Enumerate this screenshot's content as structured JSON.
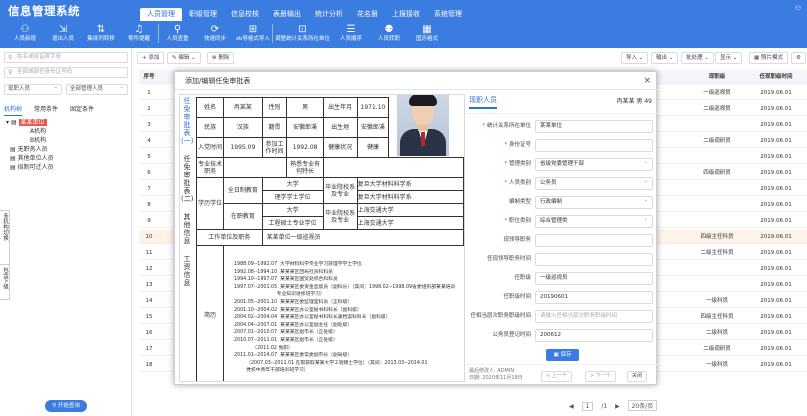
{
  "app": {
    "title": "信息管理系统"
  },
  "menu": [
    "人员管理",
    "职级管理",
    "信息校核",
    "表册输出",
    "统计分析",
    "花名册",
    "上报接收",
    "系统管理"
  ],
  "toolbar": [
    "人员新增",
    "退出人员",
    "集体列转移",
    "零件提醒",
    "人员查重",
    "快速同步",
    "zb导格式导入",
    "调整统计关系所在单位",
    "人员顺序",
    "人员转职",
    "国历格式"
  ],
  "sidebar": {
    "search1": "姓名或拼音首字母",
    "search2": "全部城部任身份证号码",
    "scope": "现职人员",
    "unit": "全部管理人员",
    "tabs": [
      "机构树",
      "常用条件",
      "固定条件"
    ],
    "tree": [
      "某某单位",
      "A机构",
      "B机构",
      "无职务人员",
      "其他单位人员",
      "拟制可迁人员"
    ],
    "vtab": "多机构切换",
    "vtab2": "包含下级",
    "start": "开始查询"
  },
  "main_toolbar": {
    "add": "添加",
    "edit": "编辑",
    "delete": "删除",
    "import": "导入",
    "export": "输出",
    "batch": "批处理",
    "display": "显示",
    "photo": "照片模式"
  },
  "grid": {
    "left_head": "序号",
    "cols": [
      "现职级",
      "任现职级时间"
    ],
    "rows": [
      {
        "no": "1",
        "rank": "一级巡视员",
        "date": "2019.06.01"
      },
      {
        "no": "2",
        "rank": "二级巡视员",
        "date": "2019.06.01"
      },
      {
        "no": "3",
        "rank": "",
        "date": "2019.06.01"
      },
      {
        "no": "4",
        "rank": "二级调研员",
        "date": "2019.06.01"
      },
      {
        "no": "5",
        "rank": "",
        "date": "2019.06.01"
      },
      {
        "no": "6",
        "rank": "四级调研员",
        "date": "2019.06.01"
      },
      {
        "no": "7",
        "rank": "",
        "date": "2019.06.01"
      },
      {
        "no": "8",
        "rank": "",
        "date": "2019.06.01"
      },
      {
        "no": "9",
        "rank": "",
        "date": "2019.06.01"
      },
      {
        "no": "10",
        "rank": "四级主任科员",
        "date": "2019.06.01"
      },
      {
        "no": "11",
        "rank": "二级主任科员",
        "date": "2019.06.01"
      },
      {
        "no": "12",
        "rank": "",
        "date": "2019.06.01"
      },
      {
        "no": "13",
        "rank": "",
        "date": "2019.06.01"
      },
      {
        "no": "14",
        "rank": "一级科员",
        "date": "2019.06.01"
      },
      {
        "no": "15",
        "rank": "四级主任科员",
        "date": "2019.06.01"
      },
      {
        "no": "16",
        "rank": "二级科员",
        "date": "2019.06.01"
      },
      {
        "no": "17",
        "rank": "二级调研员",
        "date": "2019.06.01"
      },
      {
        "no": "18",
        "rank": "一级科员",
        "date": "2019.06.01"
      }
    ]
  },
  "pager": {
    "page": "1",
    "total": "/1",
    "size": "20条/页"
  },
  "modal": {
    "title": "添加/编辑任免审批表",
    "close": "×",
    "vt": [
      "任免审批表(一)",
      "任免审批表(二)",
      "其他信息",
      "工资信息"
    ],
    "form": {
      "name_l": "姓名",
      "name": "冉某某",
      "sex_l": "性别",
      "sex": "男",
      "birth_l": "出生年月",
      "birth": "1971.10",
      "nation_l": "民族",
      "nation": "汉族",
      "native_l": "籍贯",
      "native": "安徽郎溪",
      "bp_l": "出生地",
      "bp": "安徽郎溪",
      "party_l": "入党时间",
      "party": "1995.09",
      "work_l": "参加工作时间",
      "work": "1992.08",
      "health_l": "健康状况",
      "health": "健康",
      "tech_l": "专业技术职务",
      "spec_l": "熟悉专业有何特长",
      "edu_l": "学历学位",
      "ft_l": "全日制教育",
      "ft_edu": "大学",
      "ft_deg": "理学学士学位",
      "ft_sch_l": "毕业院校系及专业",
      "ft_sch1": "复旦大学材料科学系",
      "ft_sch2": "复旦大学材料科学系",
      "ij_l": "在职教育",
      "ij_edu": "大学",
      "ij_deg": "工程硕士专业学位",
      "ij_sch_l": "毕业院校系及专业",
      "ij_sch1": "上海交通大学",
      "ij_sch2": "上海交通大学",
      "pos_l": "工作单位及职务",
      "pos": "某某单位一级巡视员",
      "resume_l": "简历",
      "resume": [
        "1988.09--1992.07  大学材料科学专业学习获理学学士学位",
        "1992.08--1994.10  某某某区团局社员科科员",
        "1994.10--1997.07  某某某区国贸处综合科科员",
        "1997.07--2001.05  某某某区委资金监督员（副科长）（其间：1998.02--1998.09省委组织部某某培训",
        "                            专业知识进修班学习）",
        "2001.05--2001.10  某某某区委监理室科员（正科级）",
        "2001.10--2004.02  某某某区办公室秘书科科长（副科级）",
        "2004.02--2004.04  某某某区办公室秘书科科长兼档案科科长（副科级）",
        "2004.04--2007.01  某某某区办公室副主任（副处级）",
        "2007.01--2010.07  某某某区副市长（正处级）",
        "2010.07--2011.01  某某某区副市长（正处级）",
        "            （2011.02 免职）",
        "2011.01--2014.07  某某某区委常委副市长（副局级）",
        "        （2007.03--2011.01 在职获取某某大学工程硕士学位）（其间：2013.03--2014.01",
        "        党校中青年干部培训班学习）"
      ]
    },
    "panel": {
      "tab": "现职人员",
      "person": "冉某某 男 49",
      "fields": [
        {
          "label": "统计关系所在单位",
          "req": true,
          "value": "某某单位",
          "ph": false,
          "dd": false
        },
        {
          "label": "身份证号",
          "req": true,
          "value": "",
          "ph": false,
          "dd": false
        },
        {
          "label": "管理类别",
          "req": true,
          "value": "省级党委管理干部",
          "ph": false,
          "dd": true
        },
        {
          "label": "人员类别",
          "req": true,
          "value": "公务员",
          "ph": false,
          "dd": true
        },
        {
          "label": "编制类型",
          "req": false,
          "value": "行政编制",
          "ph": false,
          "dd": true
        },
        {
          "label": "职位类别",
          "req": true,
          "value": "综合管理类",
          "ph": false,
          "dd": true
        },
        {
          "label": "现领导职务",
          "req": false,
          "value": "",
          "ph": false,
          "dd": false
        },
        {
          "label": "任现领导职务时间",
          "req": false,
          "value": "",
          "ph": false,
          "dd": false
        },
        {
          "label": "任职级",
          "req": false,
          "value": "一级巡视员",
          "ph": false,
          "dd": false
        },
        {
          "label": "任职级时间",
          "req": false,
          "value": "20190601",
          "ph": false,
          "dd": false
        },
        {
          "label": "任相当层次职务职级时间",
          "req": false,
          "value": "请输入任相当层次职务职级时间",
          "ph": true,
          "dd": false
        },
        {
          "label": "公务员登记时间",
          "req": false,
          "value": "200612",
          "ph": false,
          "dd": false
        }
      ],
      "save": "保存",
      "modifier": "最后修改人: ADMIN",
      "modtime": "日期: 2020年11月19日",
      "prev": "< 上一个",
      "next": "> 下一个",
      "close": "关闭"
    }
  }
}
